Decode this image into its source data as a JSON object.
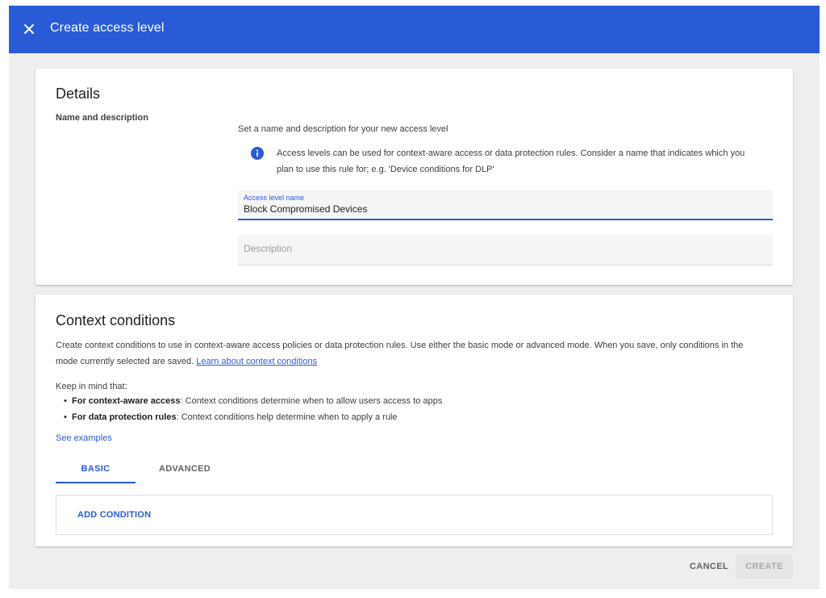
{
  "header": {
    "title": "Create access level",
    "close_icon": "close-icon",
    "background_color": "#2a5bd7"
  },
  "details": {
    "title": "Details",
    "subsection_label": "Name and description",
    "intro": "Set a name and description for your new access level",
    "info_icon": "info-icon",
    "info_line1": "Access levels can be used for context-aware access or data protection rules. Consider a name that indicates which you",
    "info_line2": "plan to use this rule for; e.g. 'Device conditions for DLP'",
    "name_field": {
      "label": "Access level name",
      "value": "Block Compromised Devices"
    },
    "description_field": {
      "placeholder": "Description",
      "value": ""
    }
  },
  "context": {
    "title": "Context conditions",
    "desc_line1": "Create context conditions to use in context-aware access policies or data protection rules. Use either the basic mode or advanced mode. When you save, only conditions in the",
    "desc_line2": "mode currently selected are saved. ",
    "learn_link": "Learn about context conditions",
    "keep_in_mind": "Keep in mind that:",
    "bullets": [
      {
        "bold": "For context-aware access",
        "text": ": Context conditions determine when to allow users access to apps"
      },
      {
        "bold": "For data protection rules",
        "text": ": Context conditions help determine when to apply a rule"
      }
    ],
    "see_examples": "See examples",
    "tabs": [
      {
        "label": "BASIC",
        "selected": true
      },
      {
        "label": "ADVANCED",
        "selected": false
      }
    ],
    "add_condition": "ADD CONDITION"
  },
  "footer": {
    "cancel": "CANCEL",
    "create": "CREATE",
    "create_disabled": true
  }
}
